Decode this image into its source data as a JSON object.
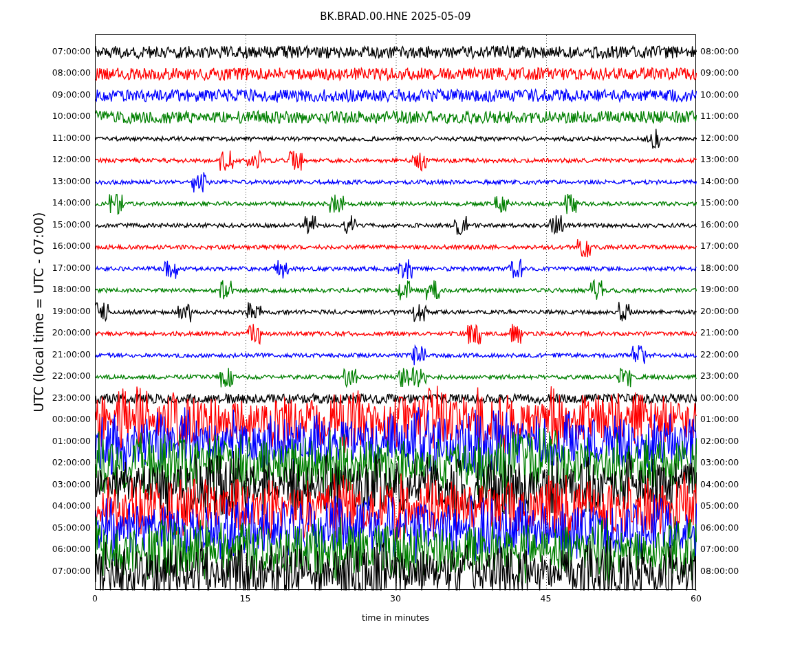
{
  "title": "BK.BRAD.00.HNE 2025-05-09",
  "y_label": "UTC (local time = UTC - 07:00)",
  "x_label": "time in minutes",
  "x_ticks": [
    "0",
    "15",
    "30",
    "45",
    "60"
  ],
  "rows": [
    {
      "left": "07:00:00",
      "right": "08:00:00",
      "color": "#000000"
    },
    {
      "left": "08:00:00",
      "right": "09:00:00",
      "color": "#ff0000"
    },
    {
      "left": "09:00:00",
      "right": "10:00:00",
      "color": "#0000ff"
    },
    {
      "left": "10:00:00",
      "right": "11:00:00",
      "color": "#008000"
    },
    {
      "left": "11:00:00",
      "right": "12:00:00",
      "color": "#000000"
    },
    {
      "left": "12:00:00",
      "right": "13:00:00",
      "color": "#ff0000"
    },
    {
      "left": "13:00:00",
      "right": "14:00:00",
      "color": "#0000ff"
    },
    {
      "left": "14:00:00",
      "right": "15:00:00",
      "color": "#008000"
    },
    {
      "left": "15:00:00",
      "right": "16:00:00",
      "color": "#000000"
    },
    {
      "left": "16:00:00",
      "right": "17:00:00",
      "color": "#ff0000"
    },
    {
      "left": "17:00:00",
      "right": "18:00:00",
      "color": "#0000ff"
    },
    {
      "left": "18:00:00",
      "right": "19:00:00",
      "color": "#008000"
    },
    {
      "left": "19:00:00",
      "right": "20:00:00",
      "color": "#000000"
    },
    {
      "left": "20:00:00",
      "right": "21:00:00",
      "color": "#ff0000"
    },
    {
      "left": "21:00:00",
      "right": "22:00:00",
      "color": "#0000ff"
    },
    {
      "left": "22:00:00",
      "right": "23:00:00",
      "color": "#008000"
    },
    {
      "left": "23:00:00",
      "right": "00:00:00",
      "color": "#000000"
    },
    {
      "left": "00:00:00",
      "right": "01:00:00",
      "color": "#ff0000"
    },
    {
      "left": "01:00:00",
      "right": "02:00:00",
      "color": "#0000ff"
    },
    {
      "left": "02:00:00",
      "right": "03:00:00",
      "color": "#008000"
    },
    {
      "left": "03:00:00",
      "right": "04:00:00",
      "color": "#000000"
    },
    {
      "left": "04:00:00",
      "right": "05:00:00",
      "color": "#ff0000"
    },
    {
      "left": "05:00:00",
      "right": "06:00:00",
      "color": "#0000ff"
    },
    {
      "left": "06:00:00",
      "right": "07:00:00",
      "color": "#008000"
    },
    {
      "left": "07:00:00",
      "right": "08:00:00",
      "color": "#000000"
    }
  ]
}
